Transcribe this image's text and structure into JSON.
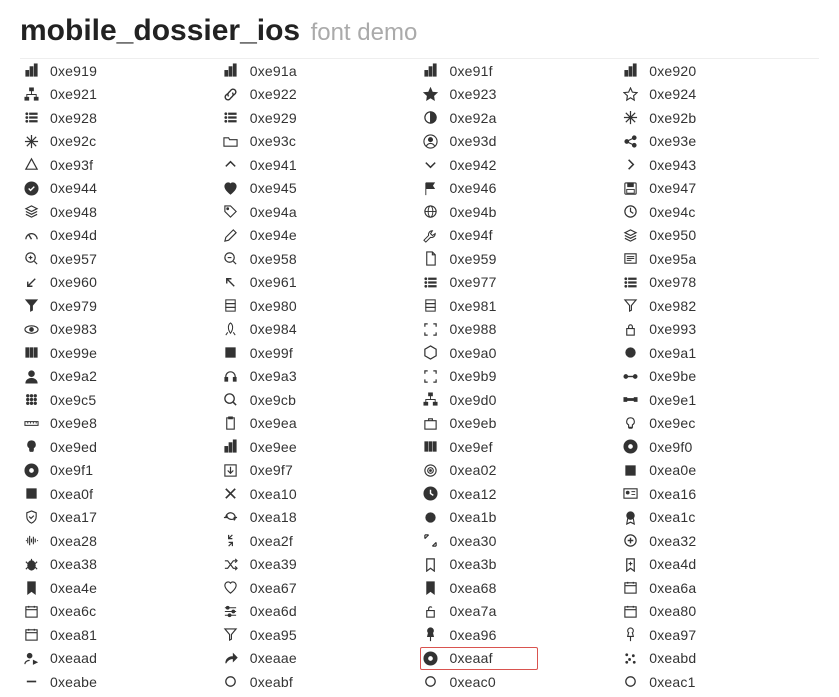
{
  "header": {
    "title": "mobile_dossier_ios",
    "subtitle": "font demo"
  },
  "glyphs": [
    {
      "code": "0xe919",
      "icon": "bar-chart-icon"
    },
    {
      "code": "0xe91a",
      "icon": "bar-chart-alt-icon"
    },
    {
      "code": "0xe91f",
      "icon": "bar-chart-wide-icon"
    },
    {
      "code": "0xe920",
      "icon": "bar-chart-tall-icon"
    },
    {
      "code": "0xe921",
      "icon": "sitemap-icon"
    },
    {
      "code": "0xe922",
      "icon": "link-icon"
    },
    {
      "code": "0xe923",
      "icon": "star-filled-icon"
    },
    {
      "code": "0xe924",
      "icon": "star-outline-icon"
    },
    {
      "code": "0xe928",
      "icon": "list-icon"
    },
    {
      "code": "0xe929",
      "icon": "list-alt-icon"
    },
    {
      "code": "0xe92a",
      "icon": "contrast-icon"
    },
    {
      "code": "0xe92b",
      "icon": "asterisk-icon"
    },
    {
      "code": "0xe92c",
      "icon": "snowflake-icon"
    },
    {
      "code": "0xe93c",
      "icon": "folder-open-icon"
    },
    {
      "code": "0xe93d",
      "icon": "user-circle-icon"
    },
    {
      "code": "0xe93e",
      "icon": "share-nodes-icon"
    },
    {
      "code": "0xe93f",
      "icon": "triangle-outline-icon"
    },
    {
      "code": "0xe941",
      "icon": "chevron-up-icon"
    },
    {
      "code": "0xe942",
      "icon": "chevron-down-icon"
    },
    {
      "code": "0xe943",
      "icon": "chevron-right-icon"
    },
    {
      "code": "0xe944",
      "icon": "check-circle-filled-icon"
    },
    {
      "code": "0xe945",
      "icon": "heart-filled-icon"
    },
    {
      "code": "0xe946",
      "icon": "flag-filled-icon"
    },
    {
      "code": "0xe947",
      "icon": "save-icon"
    },
    {
      "code": "0xe948",
      "icon": "layers-icon"
    },
    {
      "code": "0xe94a",
      "icon": "tag-icon"
    },
    {
      "code": "0xe94b",
      "icon": "globe-icon"
    },
    {
      "code": "0xe94c",
      "icon": "clock-outline-icon"
    },
    {
      "code": "0xe94d",
      "icon": "gauge-icon"
    },
    {
      "code": "0xe94e",
      "icon": "pencil-icon"
    },
    {
      "code": "0xe94f",
      "icon": "wrench-icon"
    },
    {
      "code": "0xe950",
      "icon": "layers-alt-icon"
    },
    {
      "code": "0xe957",
      "icon": "zoom-in-icon"
    },
    {
      "code": "0xe958",
      "icon": "zoom-out-icon"
    },
    {
      "code": "0xe959",
      "icon": "document-icon"
    },
    {
      "code": "0xe95a",
      "icon": "news-icon"
    },
    {
      "code": "0xe960",
      "icon": "arrow-down-left-icon"
    },
    {
      "code": "0xe961",
      "icon": "arrow-up-left-icon"
    },
    {
      "code": "0xe977",
      "icon": "list-indent-icon"
    },
    {
      "code": "0xe978",
      "icon": "list-numbered-icon"
    },
    {
      "code": "0xe979",
      "icon": "funnel-filled-icon"
    },
    {
      "code": "0xe980",
      "icon": "server-icon"
    },
    {
      "code": "0xe981",
      "icon": "building-icon"
    },
    {
      "code": "0xe982",
      "icon": "funnel-outline-icon"
    },
    {
      "code": "0xe983",
      "icon": "eye-icon"
    },
    {
      "code": "0xe984",
      "icon": "rocket-icon"
    },
    {
      "code": "0xe988",
      "icon": "scan-icon"
    },
    {
      "code": "0xe993",
      "icon": "lock-icon"
    },
    {
      "code": "0xe99e",
      "icon": "columns-icon"
    },
    {
      "code": "0xe99f",
      "icon": "square-filled-icon"
    },
    {
      "code": "0xe9a0",
      "icon": "hexagon-icon"
    },
    {
      "code": "0xe9a1",
      "icon": "circle-filled-icon"
    },
    {
      "code": "0xe9a2",
      "icon": "person-icon"
    },
    {
      "code": "0xe9a3",
      "icon": "headset-icon"
    },
    {
      "code": "0xe9b9",
      "icon": "fullscreen-icon"
    },
    {
      "code": "0xe9be",
      "icon": "timeline-icon"
    },
    {
      "code": "0xe9c5",
      "icon": "dial-pad-icon"
    },
    {
      "code": "0xe9cb",
      "icon": "search-icon"
    },
    {
      "code": "0xe9d0",
      "icon": "hierarchy-icon"
    },
    {
      "code": "0xe9e1",
      "icon": "dumbbell-icon"
    },
    {
      "code": "0xe9e8",
      "icon": "ruler-icon"
    },
    {
      "code": "0xe9ea",
      "icon": "clipboard-icon"
    },
    {
      "code": "0xe9eb",
      "icon": "briefcase-icon"
    },
    {
      "code": "0xe9ec",
      "icon": "lightbulb-outline-icon"
    },
    {
      "code": "0xe9ed",
      "icon": "lightbulb-filled-icon"
    },
    {
      "code": "0xe9ee",
      "icon": "bar-chart-solid-icon"
    },
    {
      "code": "0xe9ef",
      "icon": "equalizer-icon"
    },
    {
      "code": "0xe9f0",
      "icon": "record-icon"
    },
    {
      "code": "0xe9f1",
      "icon": "badge-icon"
    },
    {
      "code": "0xe9f7",
      "icon": "download-box-icon"
    },
    {
      "code": "0xea02",
      "icon": "target-icon"
    },
    {
      "code": "0xea0e",
      "icon": "stop-icon"
    },
    {
      "code": "0xea0f",
      "icon": "rectangle-icon"
    },
    {
      "code": "0xea10",
      "icon": "close-icon"
    },
    {
      "code": "0xea12",
      "icon": "clock-filled-icon"
    },
    {
      "code": "0xea16",
      "icon": "id-card-icon"
    },
    {
      "code": "0xea17",
      "icon": "shield-check-icon"
    },
    {
      "code": "0xea18",
      "icon": "refresh-icon"
    },
    {
      "code": "0xea1b",
      "icon": "dot-icon"
    },
    {
      "code": "0xea1c",
      "icon": "award-icon"
    },
    {
      "code": "0xea28",
      "icon": "sound-wave-icon"
    },
    {
      "code": "0xea2f",
      "icon": "arrow-collapse-icon"
    },
    {
      "code": "0xea30",
      "icon": "arrow-expand-icon"
    },
    {
      "code": "0xea32",
      "icon": "plus-circle-icon"
    },
    {
      "code": "0xea38",
      "icon": "bug-icon"
    },
    {
      "code": "0xea39",
      "icon": "shuffle-icon"
    },
    {
      "code": "0xea3b",
      "icon": "bookmark-outline-icon"
    },
    {
      "code": "0xea4d",
      "icon": "bookmark-add-icon"
    },
    {
      "code": "0xea4e",
      "icon": "bookmark-filled-icon"
    },
    {
      "code": "0xea67",
      "icon": "heart-outline-icon"
    },
    {
      "code": "0xea68",
      "icon": "bookmark-solid-icon"
    },
    {
      "code": "0xea6a",
      "icon": "calendar-icon"
    },
    {
      "code": "0xea6c",
      "icon": "calendar-alt-icon"
    },
    {
      "code": "0xea6d",
      "icon": "sliders-icon"
    },
    {
      "code": "0xea7a",
      "icon": "unlock-icon"
    },
    {
      "code": "0xea80",
      "icon": "date-icon"
    },
    {
      "code": "0xea81",
      "icon": "schedule-icon"
    },
    {
      "code": "0xea95",
      "icon": "filter-alt-icon"
    },
    {
      "code": "0xea96",
      "icon": "pin-filled-icon"
    },
    {
      "code": "0xea97",
      "icon": "pin-outline-icon"
    },
    {
      "code": "0xeaad",
      "icon": "user-share-icon"
    },
    {
      "code": "0xeaae",
      "icon": "forward-icon"
    },
    {
      "code": "0xeaaf",
      "icon": "info-badge-icon",
      "highlighted": true
    },
    {
      "code": "0xeabd",
      "icon": "scatter-icon"
    },
    {
      "code": "0xeabe",
      "icon": "minus-icon"
    },
    {
      "code": "0xeabf",
      "icon": "circle-outline-icon"
    },
    {
      "code": "0xeac0",
      "icon": "ring-icon"
    },
    {
      "code": "0xeac1",
      "icon": "ring-alt-icon"
    }
  ]
}
